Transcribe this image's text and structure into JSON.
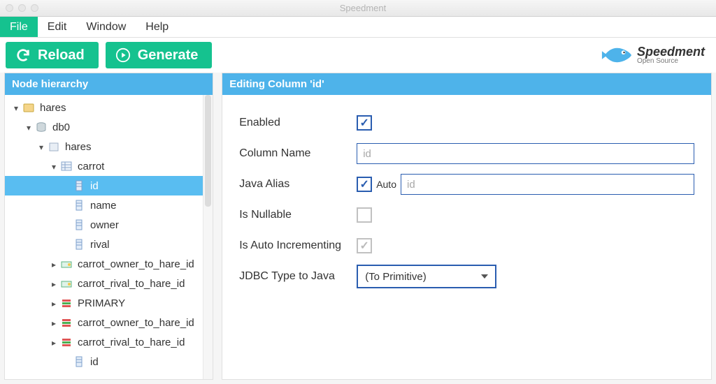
{
  "window": {
    "title": "Speedment"
  },
  "menubar": {
    "items": [
      "File",
      "Edit",
      "Window",
      "Help"
    ],
    "active_index": 0
  },
  "toolbar": {
    "reload_label": "Reload",
    "generate_label": "Generate"
  },
  "logo": {
    "big": "Speedment",
    "small": "Open Source"
  },
  "sidebar": {
    "header": "Node hierarchy",
    "items": [
      {
        "label": "hares",
        "indent": 0,
        "twisty": "open",
        "icon": "project",
        "selected": false
      },
      {
        "label": "db0",
        "indent": 1,
        "twisty": "open",
        "icon": "db",
        "selected": false
      },
      {
        "label": "hares",
        "indent": 2,
        "twisty": "open",
        "icon": "schema",
        "selected": false
      },
      {
        "label": "carrot",
        "indent": 3,
        "twisty": "open",
        "icon": "table",
        "selected": false
      },
      {
        "label": "id",
        "indent": 4,
        "twisty": "none",
        "icon": "column",
        "selected": true
      },
      {
        "label": "name",
        "indent": 4,
        "twisty": "none",
        "icon": "column",
        "selected": false
      },
      {
        "label": "owner",
        "indent": 4,
        "twisty": "none",
        "icon": "column",
        "selected": false
      },
      {
        "label": "rival",
        "indent": 4,
        "twisty": "none",
        "icon": "column",
        "selected": false
      },
      {
        "label": "carrot_owner_to_hare_id",
        "indent": 3,
        "twisty": "closed",
        "icon": "fk",
        "selected": false
      },
      {
        "label": "carrot_rival_to_hare_id",
        "indent": 3,
        "twisty": "closed",
        "icon": "fk",
        "selected": false
      },
      {
        "label": "PRIMARY",
        "indent": 3,
        "twisty": "closed",
        "icon": "idx",
        "selected": false
      },
      {
        "label": "carrot_owner_to_hare_id",
        "indent": 3,
        "twisty": "closed",
        "icon": "idx",
        "selected": false
      },
      {
        "label": "carrot_rival_to_hare_id",
        "indent": 3,
        "twisty": "closed",
        "icon": "idx",
        "selected": false
      },
      {
        "label": "id",
        "indent": 4,
        "twisty": "none",
        "icon": "column",
        "selected": false
      }
    ]
  },
  "editor": {
    "header": "Editing Column 'id'",
    "labels": {
      "enabled": "Enabled",
      "column_name": "Column Name",
      "java_alias": "Java Alias",
      "is_nullable": "Is Nullable",
      "is_auto_incrementing": "Is Auto Incrementing",
      "jdbc_type": "JDBC Type to Java",
      "auto": "Auto"
    },
    "values": {
      "enabled": true,
      "column_name": "id",
      "java_alias_auto": true,
      "java_alias_value": "id",
      "is_nullable": false,
      "is_auto_incrementing": true,
      "jdbc_type": "(To Primitive)"
    }
  }
}
